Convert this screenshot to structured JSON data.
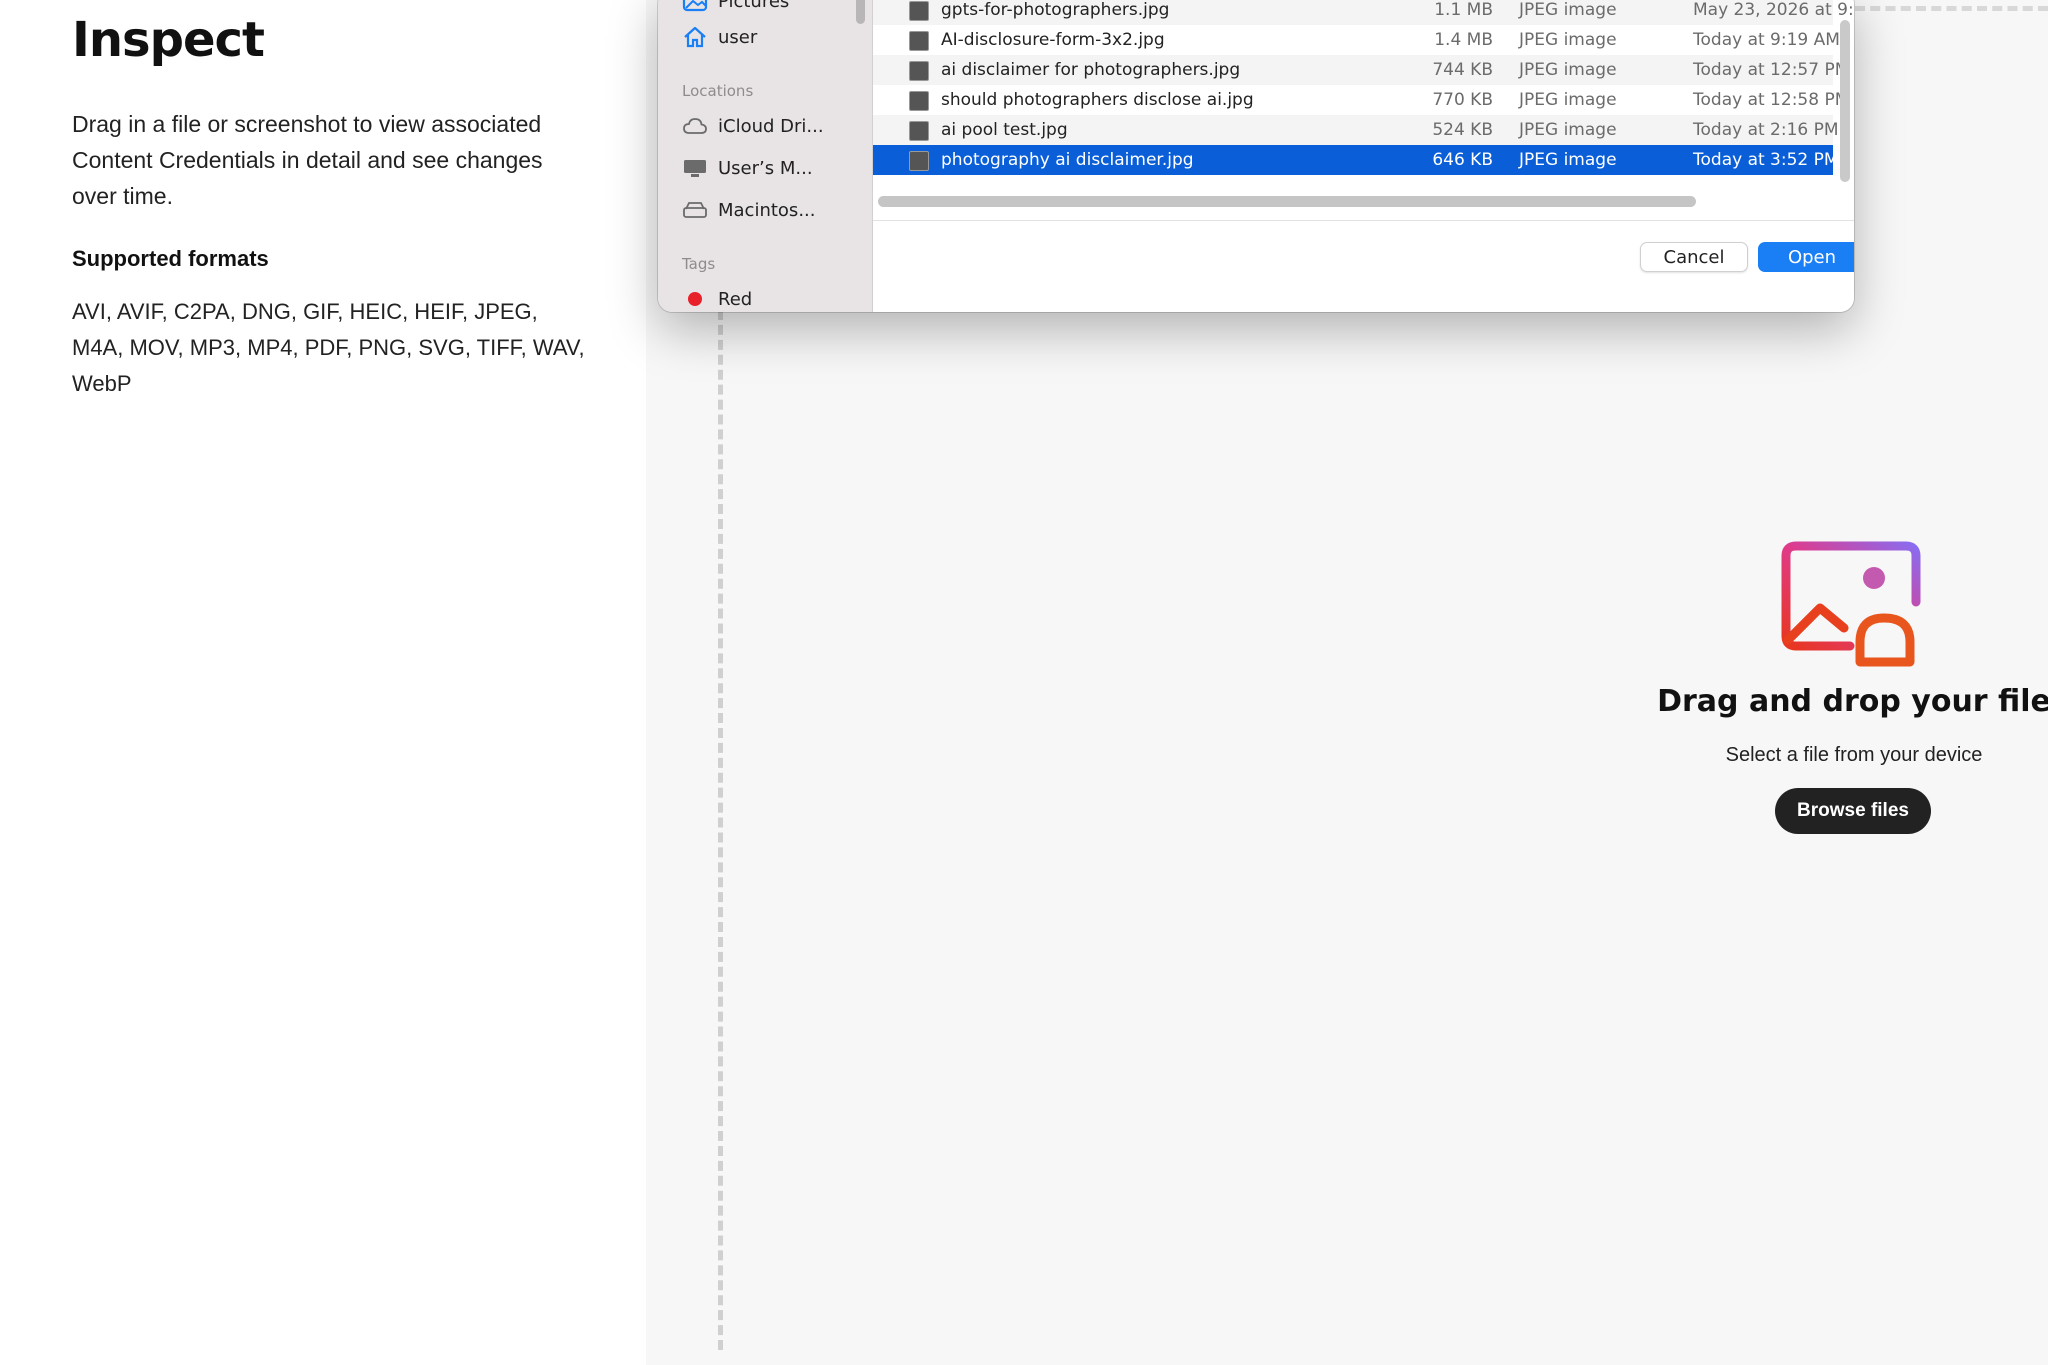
{
  "left": {
    "title": "Inspect",
    "description": "Drag in a file or screenshot to view associated Content Credentials in detail and see changes over time.",
    "formats_heading": "Supported formats",
    "formats": "AVI, AVIF, C2PA, DNG, GIF, HEIC, HEIF, JPEG, M4A, MOV, MP3, MP4, PDF, PNG, SVG, TIFF, WAV, WebP"
  },
  "dropzone": {
    "title": "Drag and drop your file",
    "subtitle": "Select a file from your device",
    "browse_label": "Browse files",
    "icon": "image-upload-icon"
  },
  "dialog": {
    "sidebar": {
      "favorites": [
        {
          "label": "Pictures",
          "icon": "pictures-icon"
        },
        {
          "label": "user",
          "icon": "home-icon"
        }
      ],
      "locations_heading": "Locations",
      "locations": [
        {
          "label": "iCloud Dri...",
          "icon": "cloud-icon"
        },
        {
          "label": "User’s M...",
          "icon": "computer-icon"
        },
        {
          "label": "Macintos...",
          "icon": "drive-icon"
        }
      ],
      "tags_heading": "Tags",
      "tags": [
        {
          "label": "Red",
          "color": "#e8202a"
        }
      ]
    },
    "files": [
      {
        "name": "gpts-for-photographers.jpg",
        "size": "1.1 MB",
        "kind": "JPEG image",
        "date": "May 23, 2026 at 9:",
        "selected": false
      },
      {
        "name": "AI-disclosure-form-3x2.jpg",
        "size": "1.4 MB",
        "kind": "JPEG image",
        "date": "Today at 9:19 AM",
        "selected": false
      },
      {
        "name": "ai disclaimer for photographers.jpg",
        "size": "744 KB",
        "kind": "JPEG image",
        "date": "Today at 12:57 PM",
        "selected": false
      },
      {
        "name": "should photographers disclose ai.jpg",
        "size": "770 KB",
        "kind": "JPEG image",
        "date": "Today at 12:58 PM",
        "selected": false
      },
      {
        "name": "ai pool test.jpg",
        "size": "524 KB",
        "kind": "JPEG image",
        "date": "Today at 2:16 PM",
        "selected": false
      },
      {
        "name": "photography ai disclaimer.jpg",
        "size": "646 KB",
        "kind": "JPEG image",
        "date": "Today at 3:52 PM",
        "selected": true
      }
    ],
    "cancel_label": "Cancel",
    "open_label": "Open",
    "selection_color": "#0a5fd8",
    "accent_color": "#1a7ef5"
  }
}
